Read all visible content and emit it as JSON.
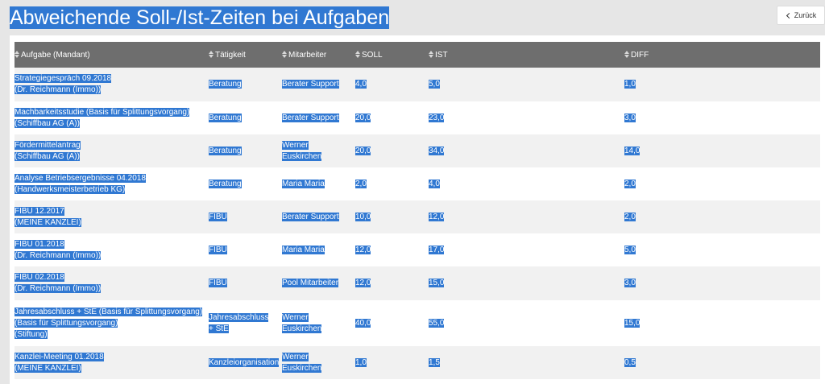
{
  "header": {
    "title": "Abweichende Soll-/Ist-Zeiten bei Aufgaben",
    "back_label": "Zurück"
  },
  "table": {
    "columns": {
      "task": "Aufgabe (Mandant)",
      "activity": "Tätigkeit",
      "employee": "Mitarbeiter",
      "soll": "SOLL",
      "ist": "IST",
      "diff": "DIFF"
    },
    "rows": [
      {
        "task": [
          "Strategiegespräch 09.2018",
          "(Dr. Reichmann (Immo))"
        ],
        "activity": [
          "Beratung"
        ],
        "employee": [
          "Berater Support"
        ],
        "soll": "4,0",
        "ist": "5,0",
        "diff": "1,0"
      },
      {
        "task": [
          "Machbarkeitsstudie (Basis für Splittungsvorgang)",
          "(Schiffbau AG (A))"
        ],
        "activity": [
          "Beratung"
        ],
        "employee": [
          "Berater Support"
        ],
        "soll": "20,0",
        "ist": "23,0",
        "diff": "3,0"
      },
      {
        "task": [
          "Fördermittelantrag",
          "(Schiffbau AG (A))"
        ],
        "activity": [
          "Beratung"
        ],
        "employee": [
          "Werner",
          "Euskirchen"
        ],
        "soll": "20,0",
        "ist": "34,0",
        "diff": "14,0"
      },
      {
        "task": [
          "Analyse Betriebsergebnisse 04.2018",
          "(Handwerksmeisterbetrieb KG)"
        ],
        "activity": [
          "Beratung"
        ],
        "employee": [
          "Maria Maria"
        ],
        "soll": "2,0",
        "ist": "4,0",
        "diff": "2,0"
      },
      {
        "task": [
          "FIBU 12.2017",
          "(MEINE KANZLEI)"
        ],
        "activity": [
          "FIBU"
        ],
        "employee": [
          "Berater Support"
        ],
        "soll": "10,0",
        "ist": "12,0",
        "diff": "2,0"
      },
      {
        "task": [
          "FIBU 01.2018",
          "(Dr. Reichmann (Immo))"
        ],
        "activity": [
          "FIBU"
        ],
        "employee": [
          "Maria Maria"
        ],
        "soll": "12,0",
        "ist": "17,0",
        "diff": "5,0"
      },
      {
        "task": [
          "FIBU 02.2018",
          "(Dr. Reichmann (Immo))"
        ],
        "activity": [
          "FIBU"
        ],
        "employee": [
          "Pool Mitarbeiter"
        ],
        "soll": "12,0",
        "ist": "15,0",
        "diff": "3,0"
      },
      {
        "task": [
          "Jahresabschluss + StE (Basis für Splittungsvorgang)",
          "(Basis für Splittungsvorgang)",
          "(Stiftung)"
        ],
        "activity": [
          "Jahresabschluss",
          "+ StE"
        ],
        "employee": [
          "Werner",
          "Euskirchen"
        ],
        "soll": "40,0",
        "ist": "55,0",
        "diff": "15,0"
      },
      {
        "task": [
          "Kanzlei-Meeting 01.2018",
          "(MEINE KANZLEI)"
        ],
        "activity": [
          "Kanzleiorganisation"
        ],
        "employee": [
          "Werner",
          "Euskirchen"
        ],
        "soll": "1,0",
        "ist": "1,5",
        "diff": "0,5"
      }
    ]
  },
  "colors": {
    "selection": "#3078d2",
    "header_bg": "#6e6e6e",
    "page_bg": "#e6e6e6"
  }
}
